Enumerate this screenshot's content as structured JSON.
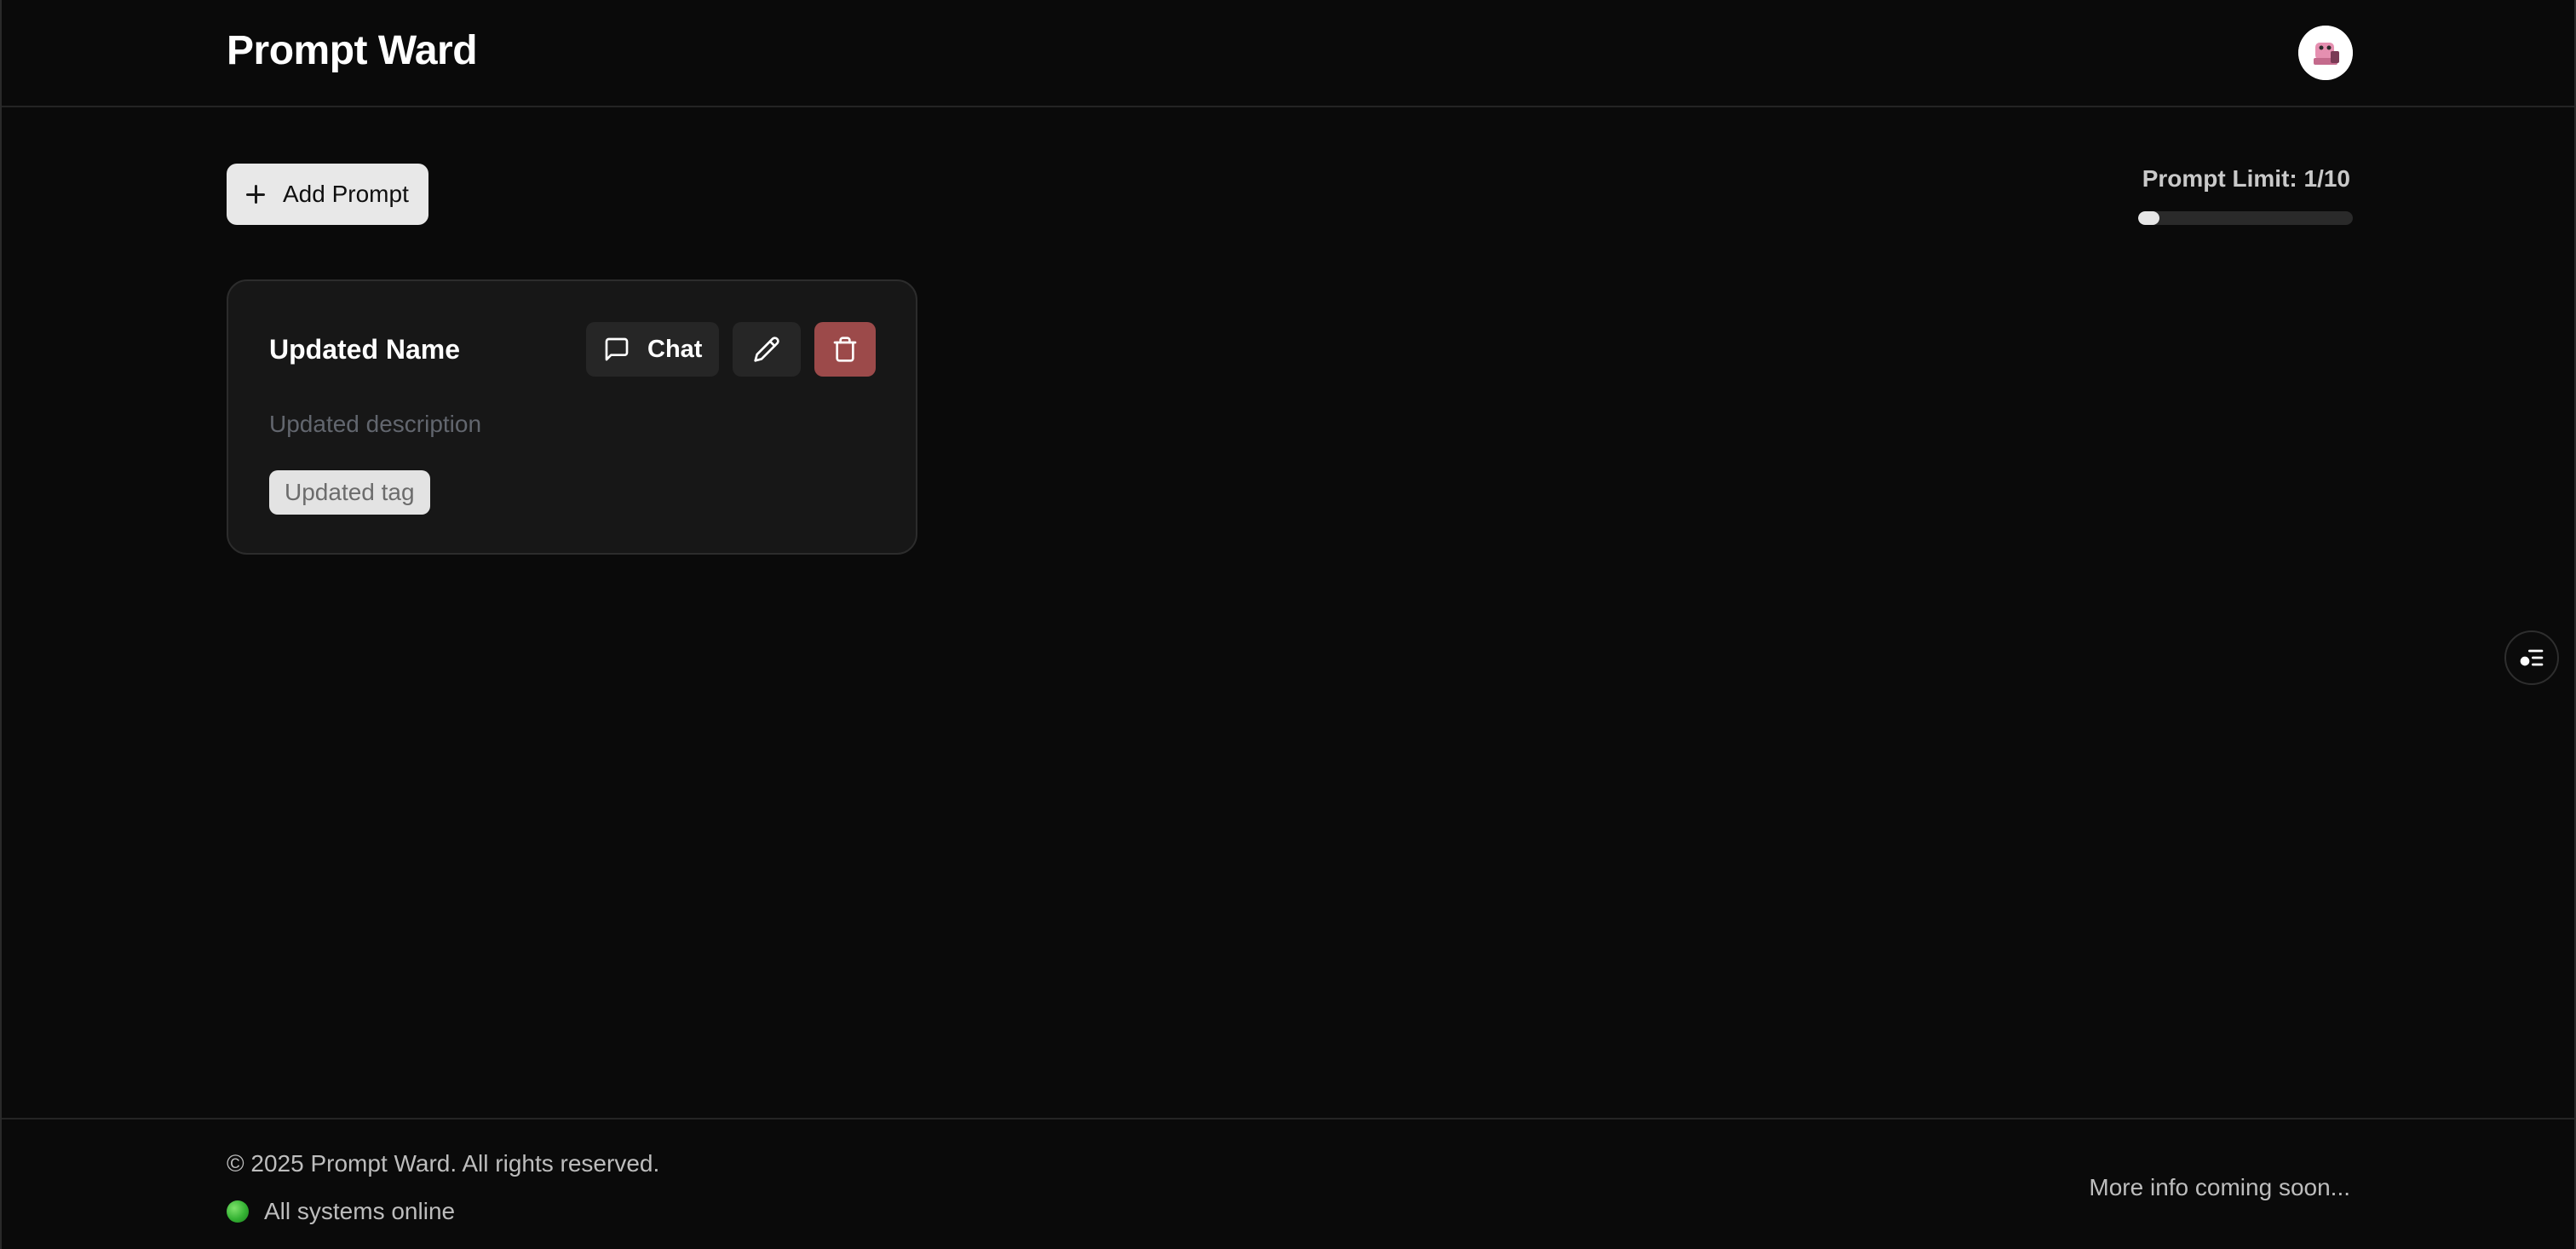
{
  "header": {
    "brand": "Prompt Ward",
    "avatar_icon": "avatar-icon"
  },
  "toolbar": {
    "add_prompt_label": "Add Prompt",
    "add_icon": "plus-icon",
    "prompt_limit_label": "Prompt Limit: 1/10",
    "prompt_limit_used": 1,
    "prompt_limit_max": 10,
    "prompt_limit_fraction": 0.1
  },
  "prompts": [
    {
      "name": "Updated Name",
      "description": "Updated description",
      "tag": "Updated tag",
      "chat_label": "Chat",
      "chat_icon": "message-square-icon",
      "edit_icon": "pencil-icon",
      "delete_icon": "trash-icon"
    }
  ],
  "side_button": {
    "icon": "settings-list-icon"
  },
  "footer": {
    "copyright": "© 2025 Prompt Ward. All rights reserved.",
    "status": "All systems online",
    "status_color": "#34b233",
    "more_info": "More info coming soon..."
  },
  "colors": {
    "background": "#0a0a0a",
    "card": "#171717",
    "danger": "#9c4a4a"
  }
}
